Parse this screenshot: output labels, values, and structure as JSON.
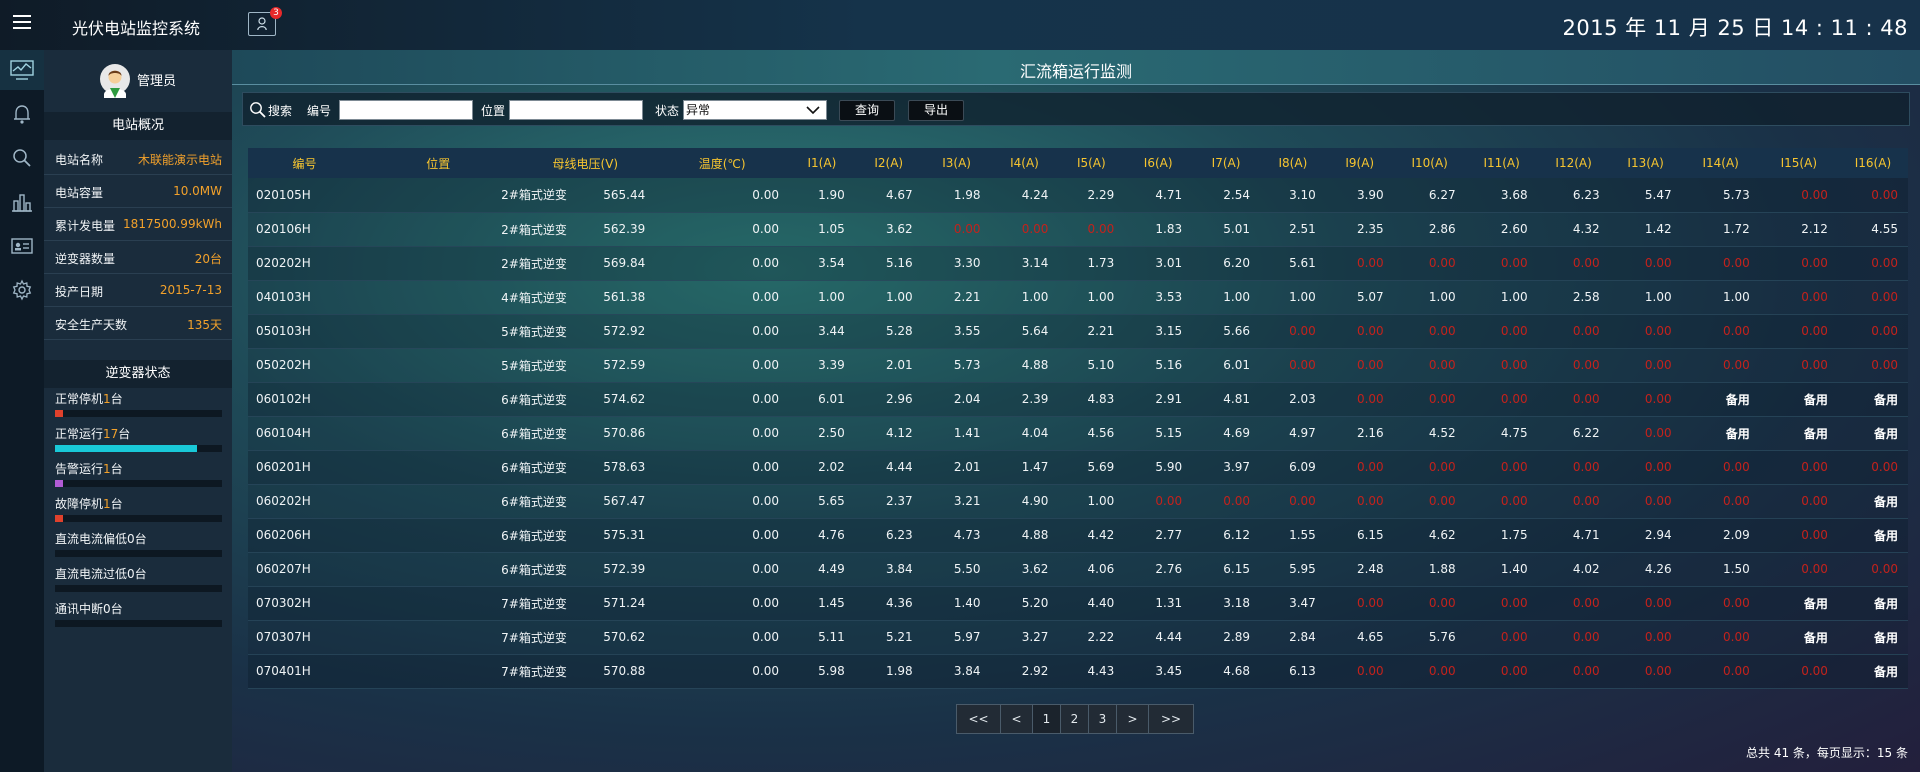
{
  "app": {
    "title": "光伏电站监控系统",
    "notification_count": "3",
    "datetime": "2015 年 11 月 25 日  14 : 11 : 48"
  },
  "rail": [
    "monitor-icon",
    "bell-icon",
    "search-icon",
    "bar-chart-icon",
    "id-card-icon",
    "gear-icon"
  ],
  "sidebar": {
    "admin_name": "管理员",
    "overview_title": "电站概况",
    "info": [
      {
        "label": "电站名称",
        "value": "木联能演示电站"
      },
      {
        "label": "电站容量",
        "value": "10.0MW"
      },
      {
        "label": "累计发电量",
        "value": "1817500.99kWh"
      },
      {
        "label": "逆变器数量",
        "value": "20台"
      },
      {
        "label": "投产日期",
        "value": "2015-7-13"
      },
      {
        "label": "安全生产天数",
        "value": "135天"
      }
    ],
    "status_title": "逆变器状态",
    "status": [
      {
        "prefix": "正常停机",
        "count": "1",
        "suffix": "台",
        "ratio": 0.05,
        "color": "#e0412c"
      },
      {
        "prefix": "正常运行",
        "count": "17",
        "suffix": "台",
        "ratio": 0.85,
        "color": "#19c9d8"
      },
      {
        "prefix": "告警运行",
        "count": "1",
        "suffix": "台",
        "ratio": 0.05,
        "color": "#b25cd6"
      },
      {
        "prefix": "故障停机",
        "count": "1",
        "suffix": "台",
        "ratio": 0.05,
        "color": "#e0412c"
      },
      {
        "prefix": "直流电流偏低0台",
        "count": "",
        "suffix": "",
        "ratio": 0,
        "color": "#19c9d8"
      },
      {
        "prefix": "直流电流过低0台",
        "count": "",
        "suffix": "",
        "ratio": 0,
        "color": "#19c9d8"
      },
      {
        "prefix": "通讯中断0台",
        "count": "",
        "suffix": "",
        "ratio": 0,
        "color": "#19c9d8"
      }
    ]
  },
  "main": {
    "title": "汇流箱运行监测",
    "search": {
      "label": "搜索",
      "id_label": "编号",
      "id_value": "",
      "loc_label": "位置",
      "loc_value": "",
      "status_label": "状态",
      "status_value": "异常",
      "query_button": "查询",
      "export_button": "导出"
    },
    "columns": [
      "编号",
      "位置",
      "母线电压(V)",
      "温度(℃)",
      "I1(A)",
      "I2(A)",
      "I3(A)",
      "I4(A)",
      "I5(A)",
      "I6(A)",
      "I7(A)",
      "I8(A)",
      "I9(A)",
      "I10(A)",
      "I11(A)",
      "I12(A)",
      "I13(A)",
      "I14(A)",
      "I15(A)",
      "I16(A)"
    ],
    "rows": [
      [
        "020105H",
        "2#箱式逆变",
        "565.44",
        "0.00",
        "1.90",
        "4.67",
        "1.98",
        "4.24",
        "2.29",
        "4.71",
        "2.54",
        "3.10",
        "3.90",
        "6.27",
        "3.68",
        "6.23",
        "5.47",
        "5.73",
        "0.00",
        "0.00"
      ],
      [
        "020106H",
        "2#箱式逆变",
        "562.39",
        "0.00",
        "1.05",
        "3.62",
        "0.00",
        "0.00",
        "0.00",
        "1.83",
        "5.01",
        "2.51",
        "2.35",
        "2.86",
        "2.60",
        "4.32",
        "1.42",
        "1.72",
        "2.12",
        "4.55"
      ],
      [
        "020202H",
        "2#箱式逆变",
        "569.84",
        "0.00",
        "3.54",
        "5.16",
        "3.30",
        "3.14",
        "1.73",
        "3.01",
        "6.20",
        "5.61",
        "0.00",
        "0.00",
        "0.00",
        "0.00",
        "0.00",
        "0.00",
        "0.00",
        "0.00"
      ],
      [
        "040103H",
        "4#箱式逆变",
        "561.38",
        "0.00",
        "1.00",
        "1.00",
        "2.21",
        "1.00",
        "1.00",
        "3.53",
        "1.00",
        "1.00",
        "5.07",
        "1.00",
        "1.00",
        "2.58",
        "1.00",
        "1.00",
        "0.00",
        "0.00"
      ],
      [
        "050103H",
        "5#箱式逆变",
        "572.92",
        "0.00",
        "3.44",
        "5.28",
        "3.55",
        "5.64",
        "2.21",
        "3.15",
        "5.66",
        "0.00",
        "0.00",
        "0.00",
        "0.00",
        "0.00",
        "0.00",
        "0.00",
        "0.00",
        "0.00"
      ],
      [
        "050202H",
        "5#箱式逆变",
        "572.59",
        "0.00",
        "3.39",
        "2.01",
        "5.73",
        "4.88",
        "5.10",
        "5.16",
        "6.01",
        "0.00",
        "0.00",
        "0.00",
        "0.00",
        "0.00",
        "0.00",
        "0.00",
        "0.00",
        "0.00"
      ],
      [
        "060102H",
        "6#箱式逆变",
        "574.62",
        "0.00",
        "6.01",
        "2.96",
        "2.04",
        "2.39",
        "4.83",
        "2.91",
        "4.81",
        "2.03",
        "0.00",
        "0.00",
        "0.00",
        "0.00",
        "0.00",
        "备用",
        "备用",
        "备用"
      ],
      [
        "060104H",
        "6#箱式逆变",
        "570.86",
        "0.00",
        "2.50",
        "4.12",
        "1.41",
        "4.04",
        "4.56",
        "5.15",
        "4.69",
        "4.97",
        "2.16",
        "4.52",
        "4.75",
        "6.22",
        "0.00",
        "备用",
        "备用",
        "备用"
      ],
      [
        "060201H",
        "6#箱式逆变",
        "578.63",
        "0.00",
        "2.02",
        "4.44",
        "2.01",
        "1.47",
        "5.69",
        "5.90",
        "3.97",
        "6.09",
        "0.00",
        "0.00",
        "0.00",
        "0.00",
        "0.00",
        "0.00",
        "0.00",
        "0.00"
      ],
      [
        "060202H",
        "6#箱式逆变",
        "567.47",
        "0.00",
        "5.65",
        "2.37",
        "3.21",
        "4.90",
        "1.00",
        "0.00",
        "0.00",
        "0.00",
        "0.00",
        "0.00",
        "0.00",
        "0.00",
        "0.00",
        "0.00",
        "0.00",
        "备用"
      ],
      [
        "060206H",
        "6#箱式逆变",
        "575.31",
        "0.00",
        "4.76",
        "6.23",
        "4.73",
        "4.88",
        "4.42",
        "2.77",
        "6.12",
        "1.55",
        "6.15",
        "4.62",
        "1.75",
        "4.71",
        "2.94",
        "2.09",
        "0.00",
        "备用"
      ],
      [
        "060207H",
        "6#箱式逆变",
        "572.39",
        "0.00",
        "4.49",
        "3.84",
        "5.50",
        "3.62",
        "4.06",
        "2.76",
        "6.15",
        "5.95",
        "2.48",
        "1.88",
        "1.40",
        "4.02",
        "4.26",
        "1.50",
        "0.00",
        "0.00"
      ],
      [
        "070302H",
        "7#箱式逆变",
        "571.24",
        "0.00",
        "1.45",
        "4.36",
        "1.40",
        "5.20",
        "4.40",
        "1.31",
        "3.18",
        "3.47",
        "0.00",
        "0.00",
        "0.00",
        "0.00",
        "0.00",
        "0.00",
        "备用",
        "备用"
      ],
      [
        "070307H",
        "7#箱式逆变",
        "570.62",
        "0.00",
        "5.11",
        "5.21",
        "5.97",
        "3.27",
        "2.22",
        "4.44",
        "2.89",
        "2.84",
        "4.65",
        "5.76",
        "0.00",
        "0.00",
        "0.00",
        "0.00",
        "备用",
        "备用"
      ],
      [
        "070401H",
        "7#箱式逆变",
        "570.88",
        "0.00",
        "5.98",
        "1.98",
        "3.84",
        "2.92",
        "4.43",
        "3.45",
        "4.68",
        "6.13",
        "0.00",
        "0.00",
        "0.00",
        "0.00",
        "0.00",
        "0.00",
        "0.00",
        "备用"
      ]
    ],
    "pager": {
      "first": "<<",
      "prev": "<",
      "pages": [
        "1",
        "2",
        "3"
      ],
      "current": "1",
      "next": ">",
      "last": ">>"
    },
    "footer": "总共 41 条，每页显示：15 条"
  }
}
